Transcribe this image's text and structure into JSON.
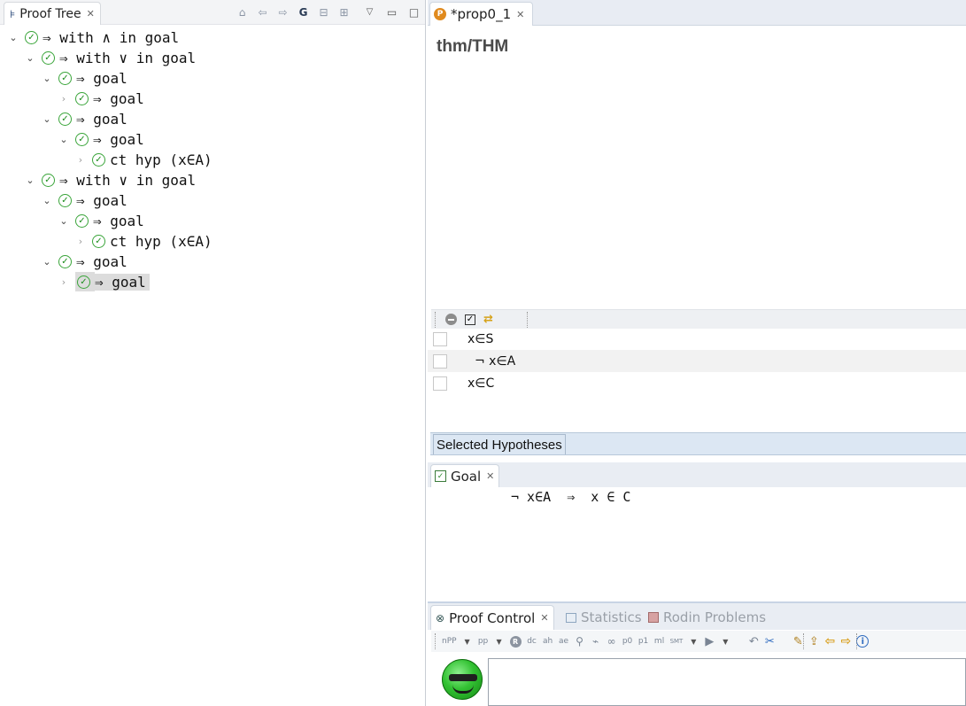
{
  "proof_tree": {
    "tab_label": "Proof Tree",
    "toolbar": [
      "home-icon",
      "back-icon",
      "forward-icon",
      "G",
      "collapse-icon",
      "expand-icon",
      "view-menu-icon",
      "minimize-icon",
      "maximize-icon"
    ],
    "nodes": [
      {
        "text": "⇒ with ∧ in goal",
        "depth": 0,
        "twisty": "open"
      },
      {
        "text": "⇒ with ∨ in goal",
        "depth": 1,
        "twisty": "open"
      },
      {
        "text": "⇒ goal",
        "depth": 2,
        "twisty": "open"
      },
      {
        "text": "⇒ goal",
        "depth": 3,
        "twisty": "closed"
      },
      {
        "text": "⇒ goal",
        "depth": 2,
        "twisty": "open"
      },
      {
        "text": "⇒ goal",
        "depth": 3,
        "twisty": "open"
      },
      {
        "text": "ct hyp (x∈A)",
        "depth": 4,
        "twisty": "closed"
      },
      {
        "text": "⇒ with ∨ in goal",
        "depth": 1,
        "twisty": "open"
      },
      {
        "text": "⇒ goal",
        "depth": 2,
        "twisty": "open"
      },
      {
        "text": "⇒ goal",
        "depth": 3,
        "twisty": "open"
      },
      {
        "text": "ct hyp (x∈A)",
        "depth": 4,
        "twisty": "closed"
      },
      {
        "text": "⇒ goal",
        "depth": 2,
        "twisty": "open"
      },
      {
        "text": "⇒ goal",
        "depth": 3,
        "twisty": "closed",
        "selected": true
      }
    ],
    "discharged_mark": "✓"
  },
  "editor": {
    "tab_label": "*prop0_1",
    "tab_icon_letter": "P",
    "title": "thm/THM"
  },
  "hypotheses": {
    "rows": [
      {
        "text": "x∈S",
        "indent": false
      },
      {
        "text": "¬ x∈A",
        "indent": true
      },
      {
        "text": "x∈C",
        "indent": false
      }
    ],
    "section_label": "Selected Hypotheses"
  },
  "goal": {
    "tab_label": "Goal",
    "text": "¬ x∈A  ⇒  x ∈ C"
  },
  "proof_control": {
    "tabs": [
      {
        "label": "Proof Control",
        "active": true
      },
      {
        "label": "Statistics",
        "active": false
      },
      {
        "label": "Rodin Problems",
        "active": false
      }
    ],
    "toolbar_buttons": [
      "nPP",
      "pp",
      "R",
      "dc",
      "ah",
      "ae",
      "p0",
      "p1",
      "ml",
      "SMT"
    ]
  },
  "colors": {
    "discharged_green": "#1c8d1c",
    "editor_tab_bar": "#e8ecf3",
    "selected_hyp_bar": "#dce7f3",
    "selection_grey": "#dcdcdc"
  }
}
